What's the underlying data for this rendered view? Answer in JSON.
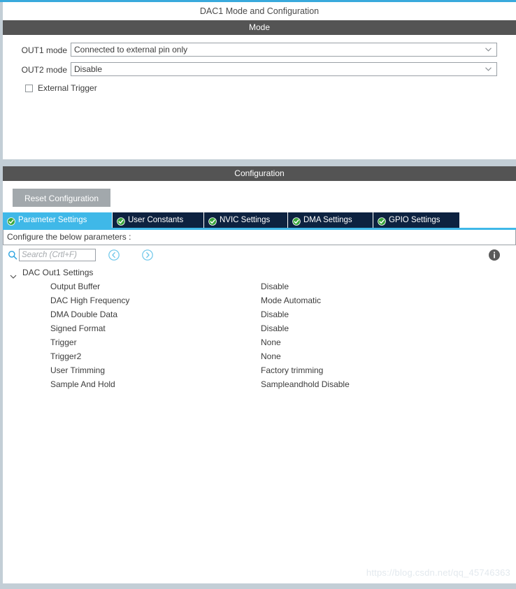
{
  "window": {
    "title": "DAC1 Mode and Configuration"
  },
  "colors": {
    "accent_blue": "#39a9dc",
    "band_gray": "#545454",
    "tab_active": "#3fb8e8",
    "tab_inactive": "#0d2240",
    "reset_button": "#a2a8ac",
    "panel_edge": "#c3ced6",
    "check_green": "#3aa63a"
  },
  "mode": {
    "band_title": "Mode",
    "out1": {
      "label": "OUT1 mode",
      "value": "Connected to external pin only",
      "icon": "chevron-down-icon"
    },
    "out2": {
      "label": "OUT2 mode",
      "value": "Disable",
      "icon": "chevron-down-icon"
    },
    "external_trigger": {
      "label": "External Trigger",
      "checked": false
    }
  },
  "configuration": {
    "band_title": "Configuration",
    "reset_label": "Reset Configuration",
    "tabs": [
      {
        "label": "Parameter Settings",
        "active": true,
        "icon": "check-circle-icon"
      },
      {
        "label": "User Constants",
        "active": false,
        "icon": "check-circle-icon"
      },
      {
        "label": "NVIC Settings",
        "active": false,
        "icon": "check-circle-icon"
      },
      {
        "label": "DMA Settings",
        "active": false,
        "icon": "check-circle-icon"
      },
      {
        "label": "GPIO Settings",
        "active": false,
        "icon": "check-circle-icon"
      }
    ],
    "configure_hint": "Configure the below parameters :",
    "search": {
      "placeholder": "Search (Crtl+F)",
      "value": "",
      "icon": "search-icon",
      "prev_icon": "chevron-left-circle-icon",
      "next_icon": "chevron-right-circle-icon"
    },
    "info_icon": "info-icon",
    "tree": {
      "group_label": "DAC Out1 Settings",
      "expanded": true,
      "caret_icon": "chevron-down-icon",
      "rows": [
        {
          "name": "Output Buffer",
          "value": "Disable"
        },
        {
          "name": "DAC High Frequency",
          "value": "Mode Automatic"
        },
        {
          "name": "DMA Double Data",
          "value": "Disable"
        },
        {
          "name": "Signed Format",
          "value": "Disable"
        },
        {
          "name": "Trigger",
          "value": "None"
        },
        {
          "name": "Trigger2",
          "value": "None"
        },
        {
          "name": "User Trimming",
          "value": "Factory trimming"
        },
        {
          "name": "Sample And Hold",
          "value": "Sampleandhold Disable"
        }
      ]
    }
  },
  "watermark": {
    "text": "https://blog.csdn.net/qq_45746363"
  }
}
